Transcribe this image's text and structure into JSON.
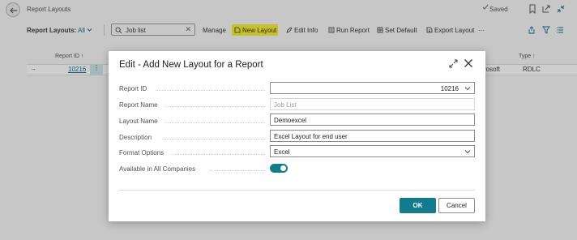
{
  "page": {
    "title": "Report Layouts",
    "saved_label": "Saved"
  },
  "toolbar": {
    "label": "Report Layouts:",
    "filter": "All",
    "search_value": "Job list",
    "manage": "Manage",
    "new_layout": "New Layout",
    "edit_info": "Edit Info",
    "run_report": "Run Report",
    "set_default": "Set Default",
    "export_layout": "Export Layout",
    "more": "···"
  },
  "grid": {
    "col_report_id": "Report ID ↑",
    "col_type": "Type ↑",
    "row": {
      "arrow": "→",
      "report_id": "10216",
      "dots": "⋮",
      "publisher_fragment": "rosoft",
      "type": "RDLC"
    }
  },
  "dialog": {
    "title": "Edit - Add New Layout for a Report",
    "fields": {
      "report_id": {
        "label": "Report ID",
        "value": "10216"
      },
      "report_name": {
        "label": "Report Name",
        "value": "Job List"
      },
      "layout_name": {
        "label": "Layout Name",
        "value": "Demoexcel"
      },
      "description": {
        "label": "Description",
        "value": "Excel Layout for end user"
      },
      "format_options": {
        "label": "Format Options",
        "value": "Excel"
      },
      "available_all_companies": {
        "label": "Available in All Companies",
        "value": "on"
      }
    },
    "ok_label": "OK",
    "cancel_label": "Cancel"
  },
  "colors": {
    "accent": "#107c8e",
    "link": "#0f6c8c",
    "highlight": "#f5ef2a"
  }
}
